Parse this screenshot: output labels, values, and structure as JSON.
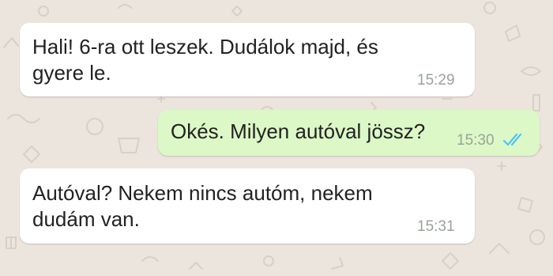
{
  "chat": {
    "background_color": "#ece5dd",
    "messages": [
      {
        "direction": "incoming",
        "text": "Hali! 6-ra ott leszek. Dudálok majd, és\ngyere le.",
        "time": "15:29"
      },
      {
        "direction": "outgoing",
        "text": "Okés. Milyen autóval jössz?",
        "time": "15:30",
        "status": "read-double-check-icon"
      },
      {
        "direction": "incoming",
        "text": "Autóval? Nekem nincs autóm, nekem\ndudám van.",
        "time": "15:31"
      }
    ]
  },
  "colors": {
    "incoming_bubble": "#ffffff",
    "outgoing_bubble": "#dcf8c6",
    "read_ticks": "#4fc3f7"
  }
}
